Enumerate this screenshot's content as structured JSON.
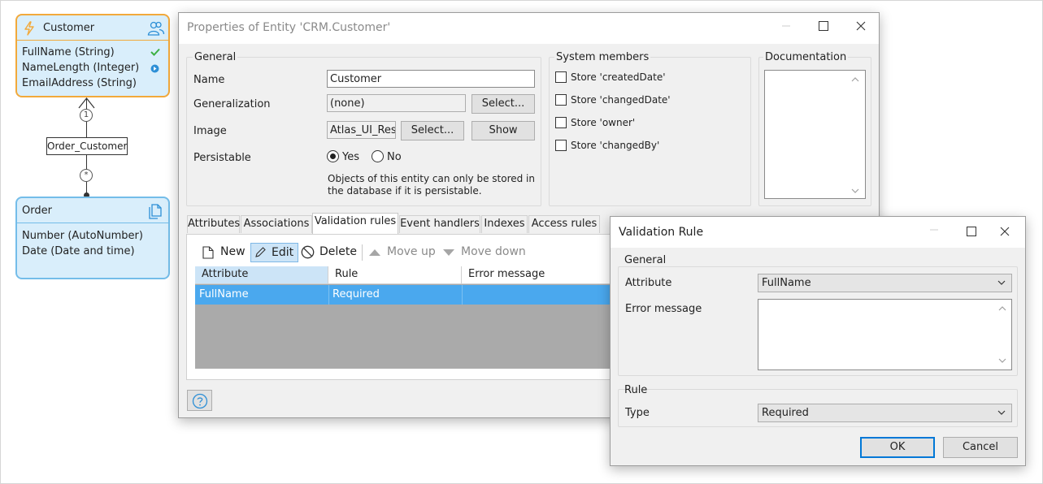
{
  "domain_model": {
    "customer_entity": {
      "title": "Customer",
      "attributes": [
        "FullName (String)",
        "NameLength (Integer)",
        "EmailAddress (String)"
      ]
    },
    "association": {
      "label": "Order_Customer",
      "top_multiplicity": "1",
      "bottom_multiplicity": "*"
    },
    "order_entity": {
      "title": "Order",
      "attributes": [
        "Number (AutoNumber)",
        "Date (Date and time)"
      ]
    }
  },
  "properties_dialog": {
    "title": "Properties of Entity 'CRM.Customer'",
    "general": {
      "group_label": "General",
      "name_label": "Name",
      "name_value": "Customer",
      "generalization_label": "Generalization",
      "generalization_value": "(none)",
      "generalization_select": "Select...",
      "image_label": "Image",
      "image_value": "Atlas_UI_Res",
      "image_select": "Select...",
      "image_show": "Show",
      "persistable_label": "Persistable",
      "yes_label": "Yes",
      "no_label": "No",
      "persistable_selected": "Yes",
      "persistable_note_line1": "Objects of this entity can only be stored in",
      "persistable_note_line2": "the database if it is persistable."
    },
    "system_members": {
      "group_label": "System members",
      "items": [
        "Store 'createdDate'",
        "Store 'changedDate'",
        "Store 'owner'",
        "Store 'changedBy'"
      ]
    },
    "documentation": {
      "group_label": "Documentation"
    },
    "tabs": [
      "Attributes",
      "Associations",
      "Validation rules",
      "Event handlers",
      "Indexes",
      "Access rules"
    ],
    "active_tab": "Validation rules",
    "toolbar": {
      "new_label": "New",
      "edit_label": "Edit",
      "delete_label": "Delete",
      "move_up_label": "Move up",
      "move_down_label": "Move down"
    },
    "grid": {
      "columns": [
        "Attribute",
        "Rule",
        "Error message"
      ],
      "rows": [
        {
          "attribute": "FullName",
          "rule": "Required",
          "error_message": ""
        }
      ]
    }
  },
  "validation_dialog": {
    "title": "Validation Rule",
    "general_label": "General",
    "attribute_label": "Attribute",
    "attribute_value": "FullName",
    "error_message_label": "Error message",
    "error_message_value": "",
    "rule_label": "Rule",
    "type_label": "Type",
    "type_value": "Required",
    "ok_label": "OK",
    "cancel_label": "Cancel"
  },
  "colors": {
    "customer_border": "#f2a93b",
    "entity_fill": "#d9eefb",
    "order_border": "#74bde9",
    "selection": "#4aa8ee",
    "ok_border": "#0078d7"
  }
}
